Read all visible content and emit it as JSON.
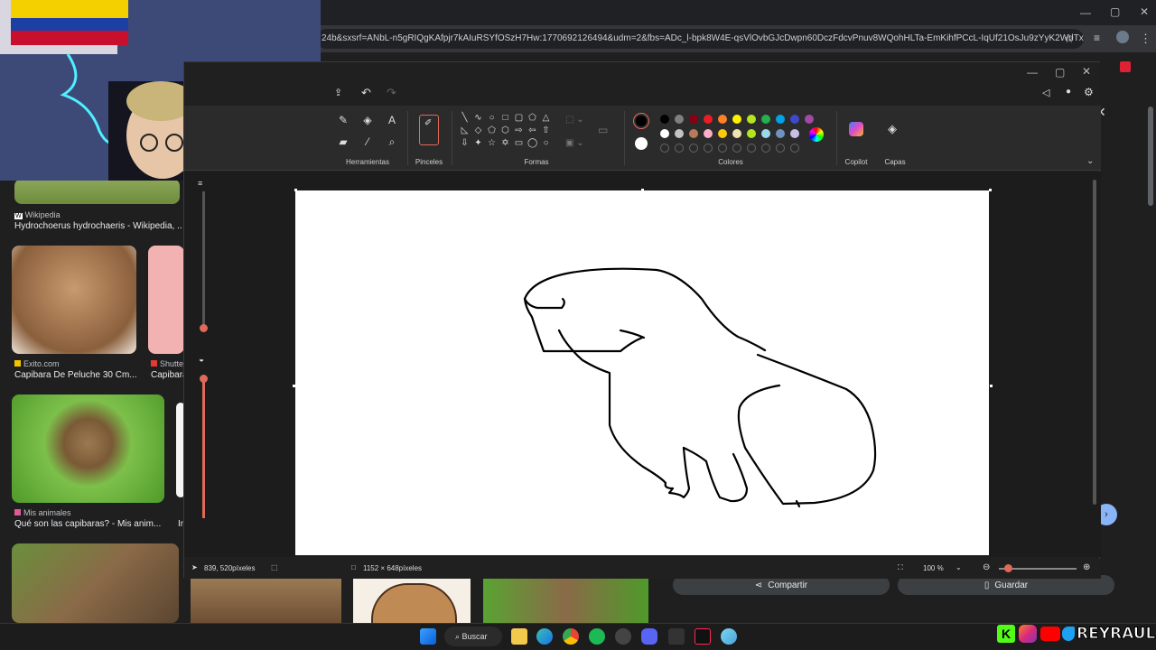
{
  "browser": {
    "url": "24b&sxsrf=ANbL-n5gRIQgKAfpjr7kAIuRSYfOSzH7Hw:1770692126494&udm=2&fbs=ADc_l-bpk8W4E-qsVlOvbGJcDwpn60DczFdcvPnuv8WQohHLTa-EmKihfPCcL-IqUf21OsJu9zYyK2WdTxmXdrNd_u..."
  },
  "results": {
    "items": [
      {
        "source": "Wikipedia",
        "title": "Hydrochoerus hydrochaeris - Wikipedia, ..."
      },
      {
        "source": "Exito.com",
        "title": "Capibara De Peluche 30 Cm..."
      },
      {
        "source": "Shutter",
        "title": "Capibara"
      },
      {
        "source": "Mis animales",
        "title": "Qué son las capibaras? - Mis anim..."
      },
      {
        "source": "",
        "title": "In"
      }
    ],
    "share_label": "Compartir",
    "save_label": "Guardar"
  },
  "paint": {
    "groups": {
      "tools": "Herramientas",
      "brushes": "Pinceles",
      "shapes": "Formas",
      "colors": "Colores",
      "copilot": "Copilot",
      "layers": "Capas"
    },
    "status": {
      "cursor": "839, 520píxeles",
      "canvas_size": "1152 × 648píxeles",
      "zoom": "100 %"
    },
    "palette": {
      "row1": [
        "#000000",
        "#7f7f7f",
        "#880015",
        "#ed1c24",
        "#ff7f27",
        "#fff200",
        "#b5e61d",
        "#22b14c",
        "#00a2e8",
        "#3f48cc",
        "#a349a4"
      ],
      "row2": [
        "#ffffff",
        "#c3c3c3",
        "#b97a57",
        "#ffaec9",
        "#ffc90e",
        "#efe4b0",
        "#b5e61d",
        "#99d9ea",
        "#7092be",
        "#c8bfe7"
      ],
      "primary": "#000000",
      "secondary": "#ffffff"
    }
  },
  "taskbar": {
    "search_label": "Buscar"
  },
  "overlay": {
    "brand": "REYRAUL"
  }
}
